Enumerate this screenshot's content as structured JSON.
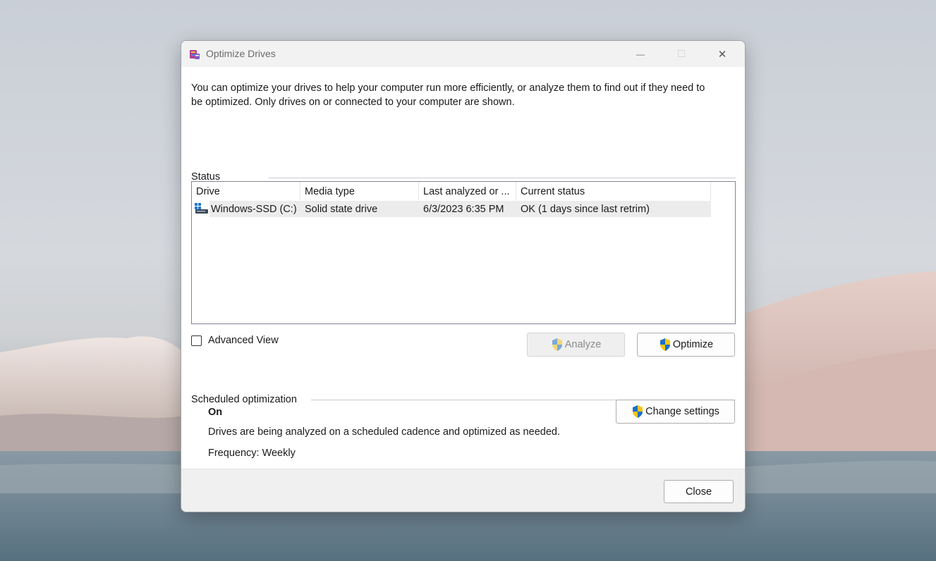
{
  "window": {
    "title": "Optimize Drives",
    "minimize_glyph": "—",
    "maximize_glyph": "□",
    "close_glyph": "✕"
  },
  "description": "You can optimize your drives to help your computer run more efficiently, or analyze them to find out if they need to be optimized. Only drives on or connected to your computer are shown.",
  "status": {
    "label": "Status",
    "columns": [
      "Drive",
      "Media type",
      "Last analyzed or ...",
      "Current status"
    ],
    "rows": [
      {
        "drive": "Windows-SSD (C:)",
        "media_type": "Solid state drive",
        "last_analyzed": "6/3/2023 6:35 PM",
        "current_status": "OK (1 days since last retrim)"
      }
    ]
  },
  "advanced_view": {
    "label": "Advanced View",
    "checked": false
  },
  "buttons": {
    "analyze": "Analyze",
    "optimize": "Optimize",
    "change_settings": "Change settings",
    "close": "Close"
  },
  "scheduled": {
    "label": "Scheduled optimization",
    "state": "On",
    "description": "Drives are being analyzed on a scheduled cadence and optimized as needed.",
    "frequency": "Frequency: Weekly"
  },
  "colors": {
    "shield_blue": "#1f6fc9",
    "shield_yellow": "#f5c518"
  },
  "icons": {
    "app": "optimize-drives-icon",
    "drive": "drive-icon",
    "shield": "uac-shield-icon"
  }
}
